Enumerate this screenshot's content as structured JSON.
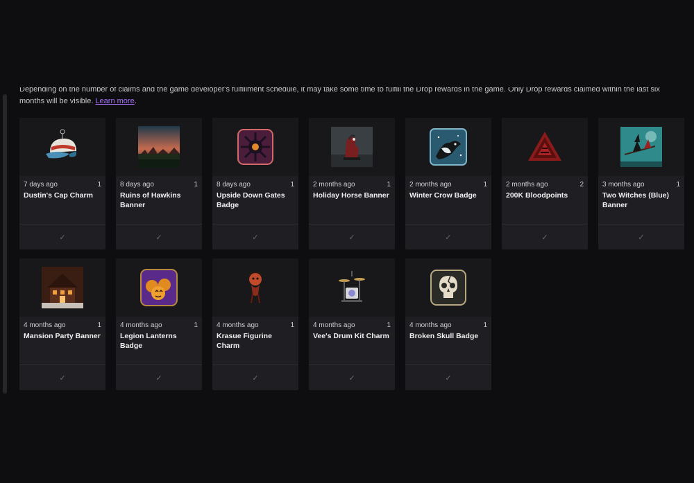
{
  "notice": {
    "line1": "Depending on the number of claims and the game developer's fulfillment schedule, it may take some time to fulfill the Drop rewards in the game. Only Drop rewards claimed within the last six",
    "line2": "months will be visible.",
    "link": "Learn more",
    "after": "."
  },
  "check_glyph": "✓",
  "drops": [
    {
      "ago": "7 days ago",
      "count": "1",
      "name": "Dustin's Cap Charm",
      "icon": "cap-icon"
    },
    {
      "ago": "8 days ago",
      "count": "1",
      "name": "Ruins of Hawkins Banner",
      "icon": "landscape-icon"
    },
    {
      "ago": "8 days ago",
      "count": "1",
      "name": "Upside Down Gates Badge",
      "icon": "gate-icon"
    },
    {
      "ago": "2 months ago",
      "count": "1",
      "name": "Holiday Horse Banner",
      "icon": "horse-icon"
    },
    {
      "ago": "2 months ago",
      "count": "1",
      "name": "Winter Crow Badge",
      "icon": "crow-icon"
    },
    {
      "ago": "2 months ago",
      "count": "2",
      "name": "200K Bloodpoints",
      "icon": "bloodpoints-icon"
    },
    {
      "ago": "3 months ago",
      "count": "1",
      "name": "Two Witches (Blue) Banner",
      "icon": "witch-icon"
    },
    {
      "ago": "4 months ago",
      "count": "1",
      "name": "Mansion Party Banner",
      "icon": "mansion-icon"
    },
    {
      "ago": "4 months ago",
      "count": "1",
      "name": "Legion Lanterns Badge",
      "icon": "pumpkin-icon"
    },
    {
      "ago": "4 months ago",
      "count": "1",
      "name": "Krasue Figurine Charm",
      "icon": "figurine-icon"
    },
    {
      "ago": "4 months ago",
      "count": "1",
      "name": "Vee's Drum Kit Charm",
      "icon": "drum-kit-icon"
    },
    {
      "ago": "4 months ago",
      "count": "1",
      "name": "Broken Skull Badge",
      "icon": "skull-icon"
    }
  ]
}
